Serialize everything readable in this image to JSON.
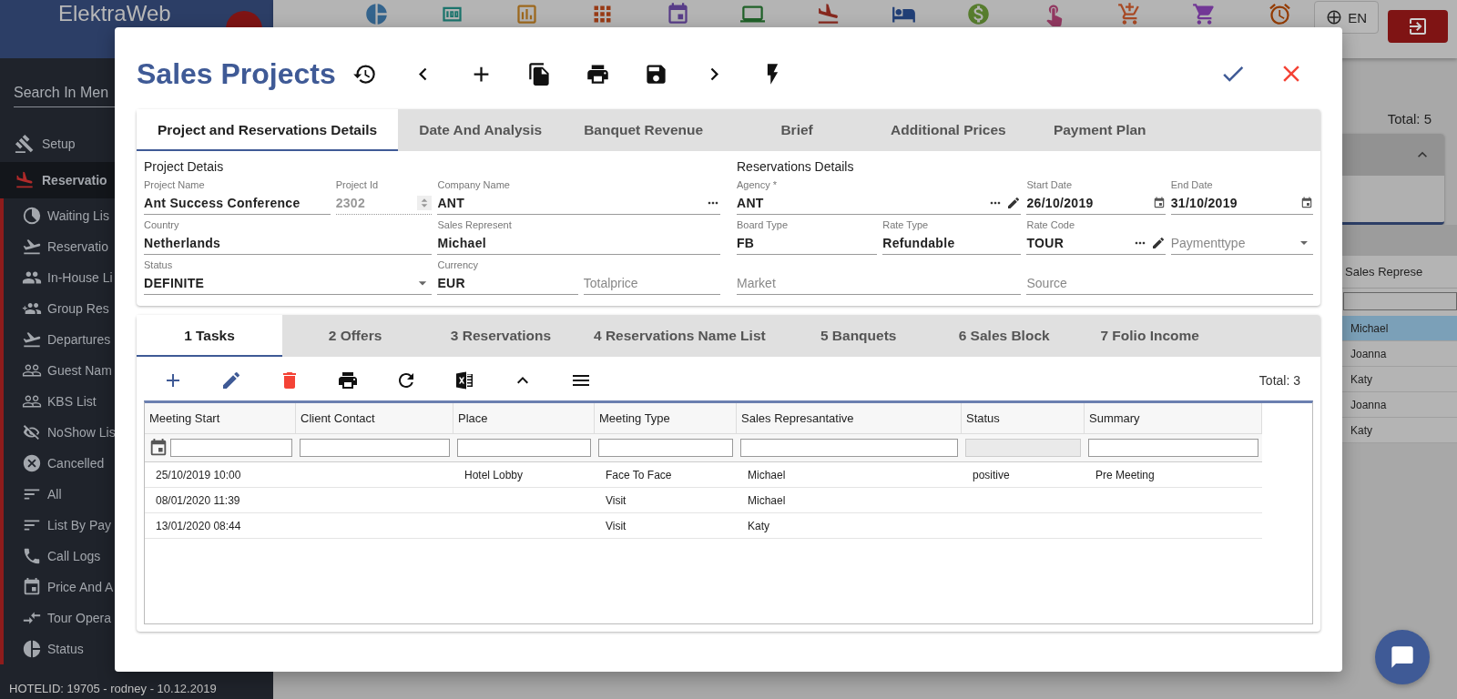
{
  "app": {
    "logo": "ElektraWeb",
    "search_placeholder": "Search In Men",
    "language": "EN",
    "footer": "HOTELID: 19705 - rodney - 10.12.2019"
  },
  "toolbar_icons": [
    {
      "color": "#34648d"
    },
    {
      "color": "#1b746c"
    },
    {
      "color": "#9d681d"
    },
    {
      "color": "#983a15"
    },
    {
      "color": "#583d88"
    },
    {
      "color": "#206129"
    },
    {
      "color": "#86281e"
    },
    {
      "color": "#213f76"
    },
    {
      "color": "#577d2e"
    },
    {
      "color": "#923861"
    },
    {
      "color": "#a84a25"
    },
    {
      "color": "#723796"
    },
    {
      "color": "#943b00"
    }
  ],
  "sidebar": {
    "items": [
      {
        "label": "Setup",
        "selected": false,
        "expanded": false
      },
      {
        "label": "Reservatio",
        "selected": true,
        "expanded": true,
        "children": [
          {
            "label": "Waiting Lis"
          },
          {
            "label": "Reservatio"
          },
          {
            "label": "In-House Li"
          },
          {
            "label": "Group Res"
          },
          {
            "label": "Departures"
          },
          {
            "label": "Guest Nam"
          },
          {
            "label": "KBS List"
          },
          {
            "label": "NoShow Lis"
          },
          {
            "label": "Cancelled"
          },
          {
            "label": "All"
          },
          {
            "label": "List By Pay"
          },
          {
            "label": "Call Logs"
          },
          {
            "label": "Price And A"
          },
          {
            "label": "Tour Opera"
          },
          {
            "label": "Status"
          }
        ]
      }
    ]
  },
  "background_list": {
    "total": "Total: 5",
    "column": "Sales Represe",
    "rows": [
      {
        "value": "Michael",
        "selected": true
      },
      {
        "value": "Joanna",
        "selected": false
      },
      {
        "value": "Katy",
        "selected": false
      },
      {
        "value": "Joanna",
        "selected": false
      },
      {
        "value": "Katy",
        "selected": false
      }
    ]
  },
  "dialog": {
    "title": "Sales Projects",
    "tabs": [
      {
        "label": "Project and Reservations Details",
        "selected": true
      },
      {
        "label": "Date And Analysis",
        "selected": false
      },
      {
        "label": "Banquet Revenue",
        "selected": false
      },
      {
        "label": "Brief",
        "selected": false
      },
      {
        "label": "Additional Prices",
        "selected": false
      },
      {
        "label": "Payment Plan",
        "selected": false
      }
    ],
    "project_details": {
      "heading": "Project Detais",
      "fields": [
        {
          "label": "Project Name",
          "value": "Ant Success Conference",
          "kind": "text",
          "disabled": false
        },
        {
          "label": "Project Id",
          "value": "2302",
          "kind": "number",
          "disabled": true
        },
        {
          "label": "Company Name",
          "value": "ANT",
          "kind": "lookup",
          "disabled": false
        },
        {
          "label": "Country",
          "value": "Netherlands",
          "kind": "text",
          "disabled": false
        },
        {
          "label": "Sales Represent",
          "value": "Michael",
          "kind": "text",
          "disabled": false
        },
        {
          "label": "Status",
          "value": "DEFINITE",
          "kind": "select",
          "disabled": false
        },
        {
          "label": "Currency",
          "value": "EUR",
          "kind": "text",
          "disabled": false
        },
        {
          "placeholder": "Totalprice",
          "kind": "text",
          "disabled": false
        }
      ]
    },
    "reservations_details": {
      "heading": "Reservations Details",
      "fields": [
        {
          "label": "Agency *",
          "value": "ANT",
          "kind": "lookup_edit",
          "disabled": false
        },
        {
          "label": "Start Date",
          "value": "26/10/2019",
          "kind": "date",
          "disabled": false
        },
        {
          "label": "End Date",
          "value": "31/10/2019",
          "kind": "date",
          "disabled": false
        },
        {
          "label": "Board Type",
          "value": "FB",
          "kind": "text",
          "disabled": false
        },
        {
          "label": "Rate Type",
          "value": "Refundable",
          "kind": "text",
          "disabled": false
        },
        {
          "label": "Rate Code",
          "value": "TOUR",
          "kind": "lookup_edit",
          "disabled": false
        },
        {
          "placeholder": "Paymenttype",
          "kind": "select",
          "disabled": false
        },
        {
          "placeholder": "Market",
          "kind": "text",
          "disabled": false
        },
        {
          "placeholder": "Source",
          "kind": "text",
          "disabled": false
        }
      ]
    },
    "detail_tabs": [
      {
        "label": "1 Tasks",
        "selected": true
      },
      {
        "label": "2 Offers",
        "selected": false
      },
      {
        "label": "3 Reservations",
        "selected": false
      },
      {
        "label": "4 Reservations Name List",
        "selected": false
      },
      {
        "label": "5 Banquets",
        "selected": false
      },
      {
        "label": "6 Sales Block",
        "selected": false
      },
      {
        "label": "7 Folio Income",
        "selected": false
      }
    ],
    "tasks": {
      "total": "Total: 3",
      "columns": [
        {
          "label": "Meeting Start",
          "kind": "date",
          "disabled": false
        },
        {
          "label": "Client Contact",
          "kind": "text",
          "disabled": false
        },
        {
          "label": "Place",
          "kind": "text",
          "disabled": false
        },
        {
          "label": "Meeting Type",
          "kind": "text",
          "disabled": false
        },
        {
          "label": "Sales Represantative",
          "kind": "text",
          "disabled": false
        },
        {
          "label": "Status",
          "kind": "text",
          "disabled": true
        },
        {
          "label": "Summary",
          "kind": "text",
          "disabled": false
        }
      ],
      "rows": [
        {
          "meeting_start": "25/10/2019 10:00",
          "place": "Hotel Lobby",
          "meeting_type": "Face To Face",
          "sales_representative": "Michael",
          "status": "positive",
          "summary": "Pre Meeting"
        },
        {
          "meeting_start": "08/01/2020 11:39",
          "meeting_type": "Visit",
          "sales_representative": "Michael"
        },
        {
          "meeting_start": "13/01/2020 08:44",
          "meeting_type": "Visit",
          "sales_representative": "Katy"
        }
      ]
    }
  }
}
